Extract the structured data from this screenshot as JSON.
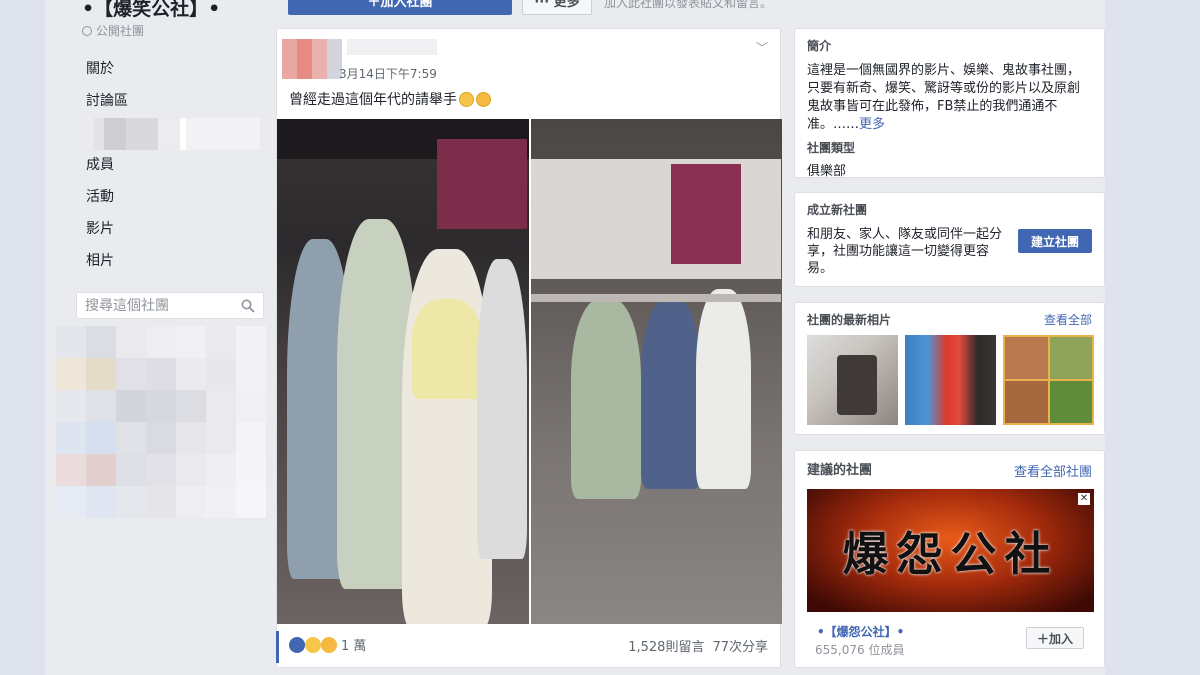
{
  "group": {
    "title": "•【爆笑公社】•",
    "privacy": "公開社團"
  },
  "nav": {
    "items": [
      "關於",
      "討論區",
      "成員",
      "活動",
      "影片",
      "相片"
    ]
  },
  "search": {
    "placeholder": "搜尋這個社團"
  },
  "topbar": {
    "join_label": "＋加入社團",
    "more_label": "··· 更多",
    "hint": "加入此社團以發表貼文和留言。"
  },
  "post": {
    "time": "3月14日下午7:59",
    "text": "曾經走過這個年代的請舉手",
    "reaction_count": "1 萬",
    "comments": "1,528則留言",
    "shares": "77次分享"
  },
  "about": {
    "heading": "簡介",
    "text": "這裡是一個無國界的影片、娛樂、鬼故事社團，只要有新奇、爆笑、驚訝等或份的影片以及原創鬼故事皆可在此發佈，FB禁止的我們通通不准。……",
    "more": "更多",
    "type_heading": "社團類型",
    "type": "俱樂部"
  },
  "create_group": {
    "heading": "成立新社團",
    "text": "和朋友、家人、隊友或同伴一起分享，社團功能讓這一切變得更容易。",
    "button": "建立社團"
  },
  "photos": {
    "heading": "社團的最新相片",
    "see_all": "查看全部"
  },
  "suggested": {
    "heading": "建議的社團",
    "see_all": "查看全部社團",
    "banner_text": "爆怨公社",
    "name": "•【爆怨公社】•",
    "members": "655,076 位成員",
    "join": "＋加入"
  }
}
